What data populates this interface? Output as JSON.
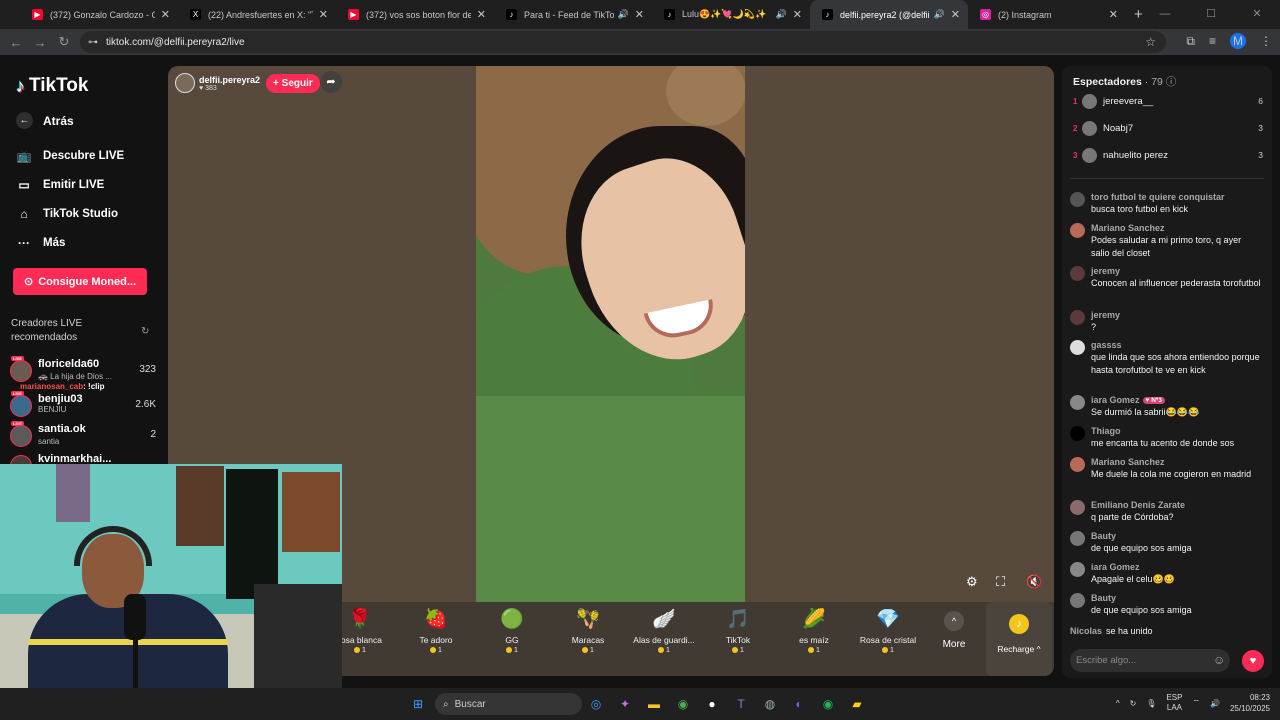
{
  "browser": {
    "tabs": [
      {
        "title": "(372) Gonzalo Cardozo - CANAL",
        "icon": "youtube-icon",
        "color": "#ff0033",
        "audio": false,
        "active": false
      },
      {
        "title": "(22) Andresfuertes en X: \"TORTU",
        "icon": "x-icon",
        "color": "#000000",
        "audio": false,
        "active": false
      },
      {
        "title": "(372) vos sos boton flor de pie...",
        "icon": "youtube-icon",
        "color": "#ff0033",
        "audio": false,
        "active": false
      },
      {
        "title": "Para ti - Feed de TikTok LIV",
        "icon": "tiktok-icon",
        "color": "#000000",
        "audio": true,
        "active": false
      },
      {
        "title": "Lulu😍✨💘🌙💫✨",
        "icon": "tiktok-icon",
        "color": "#000000",
        "audio": true,
        "active": false
      },
      {
        "title": "delfii.pereyra2 (@delfii.pere",
        "icon": "tiktok-icon",
        "color": "#000000",
        "audio": true,
        "active": true
      },
      {
        "title": "(2) Instagram",
        "icon": "instagram-icon",
        "color": "#d6249f",
        "audio": false,
        "active": false
      }
    ],
    "url": "tiktok.com/@delfii.pereyra2/live",
    "profile_initial": "M"
  },
  "sidebar": {
    "logo": "TikTok",
    "back": "Atrás",
    "menu": [
      "Descubre LIVE",
      "Emitir LIVE",
      "TikTok Studio",
      "Más"
    ],
    "coins_button": "Consigue Moned...",
    "recommended_title": "Creadores LIVE recomendados",
    "live_badge": "LIVE",
    "creators": [
      {
        "name": "floricelda60",
        "sub": "🚓 La hija de Dios ...",
        "count": "323"
      },
      {
        "name": "benjiu03",
        "sub": "BENJIU",
        "count": "2.6K"
      },
      {
        "name": "santia.ok",
        "sub": "santia",
        "count": "2"
      },
      {
        "name": "kvinmarkhai...",
        "sub": "",
        "count": ""
      }
    ]
  },
  "overlay_chat": {
    "user": "marianosan_cab",
    "message": ": !clip"
  },
  "stream": {
    "host": "delfii.pereyra2",
    "likes": "♥ 383",
    "follow": "+ Seguir"
  },
  "gifts": [
    {
      "name": "rosa blanca",
      "price": "1",
      "icon": "🌹"
    },
    {
      "name": "Te adoro",
      "price": "1",
      "icon": "🍓"
    },
    {
      "name": "GG",
      "price": "1",
      "icon": "🟢"
    },
    {
      "name": "Maracas",
      "price": "1",
      "icon": "🪇"
    },
    {
      "name": "Alas de guardi...",
      "price": "1",
      "icon": "🪽"
    },
    {
      "name": "TikTok",
      "price": "1",
      "icon": "🎵"
    },
    {
      "name": "es maíz",
      "price": "1",
      "icon": "🌽"
    },
    {
      "name": "Rosa de cristal",
      "price": "1",
      "icon": "💎"
    }
  ],
  "more_label": "More",
  "recharge_label": "Recharge ^",
  "chat": {
    "viewers_title": "Espectadores",
    "viewers_count": "· 79",
    "top_viewers": [
      {
        "rank": "1",
        "name": "jereevera__",
        "score": "6"
      },
      {
        "rank": "2",
        "name": "Noabj7",
        "score": "3"
      },
      {
        "rank": "3",
        "name": "nahuelito perez",
        "score": "3"
      }
    ],
    "messages": [
      {
        "user": "toro futbol te quiere conquistar",
        "text": "busca toro futbol en kick",
        "badge": ""
      },
      {
        "user": "Mariano Sanchez",
        "text": "Podes saludar a mi primo toro, q ayer salio del closet",
        "badge": ""
      },
      {
        "user": "jeremy",
        "text": "Conocen al influencer pederasta torofutbol",
        "badge": ""
      },
      {
        "user": "jeremy",
        "text": "?",
        "badge": ""
      },
      {
        "user": "gassss",
        "text": "que linda que sos ahora entiendoo porque hasta torofutbol te ve en kick",
        "badge": ""
      },
      {
        "user": "iara Gomez",
        "text": "Se durmió la sabrii😂😂😂",
        "badge": "♥ Nº3"
      },
      {
        "user": "Thiago",
        "text": "me encanta tu acento de donde sos",
        "badge": ""
      },
      {
        "user": "Mariano Sanchez",
        "text": "Me duele la cola me cogieron en madrid",
        "badge": ""
      },
      {
        "user": "Emiliano Denis Zarate",
        "text": "q parte de Córdoba?",
        "badge": ""
      },
      {
        "user": "Bauty",
        "text": "de que equipo sos amiga",
        "badge": ""
      },
      {
        "user": "iara Gomez",
        "text": "Apagale el celu🥴🥴",
        "badge": ""
      },
      {
        "user": "Bauty",
        "text": "de que equipo sos amiga",
        "badge": ""
      }
    ],
    "joined": {
      "user": "Nicolas",
      "text": "se ha unido"
    },
    "input_placeholder": "Escribe algo..."
  },
  "taskbar": {
    "search": "Buscar",
    "lang_1": "ESP",
    "lang_2": "LAA",
    "time": "08:23",
    "date": "25/10/2025"
  }
}
